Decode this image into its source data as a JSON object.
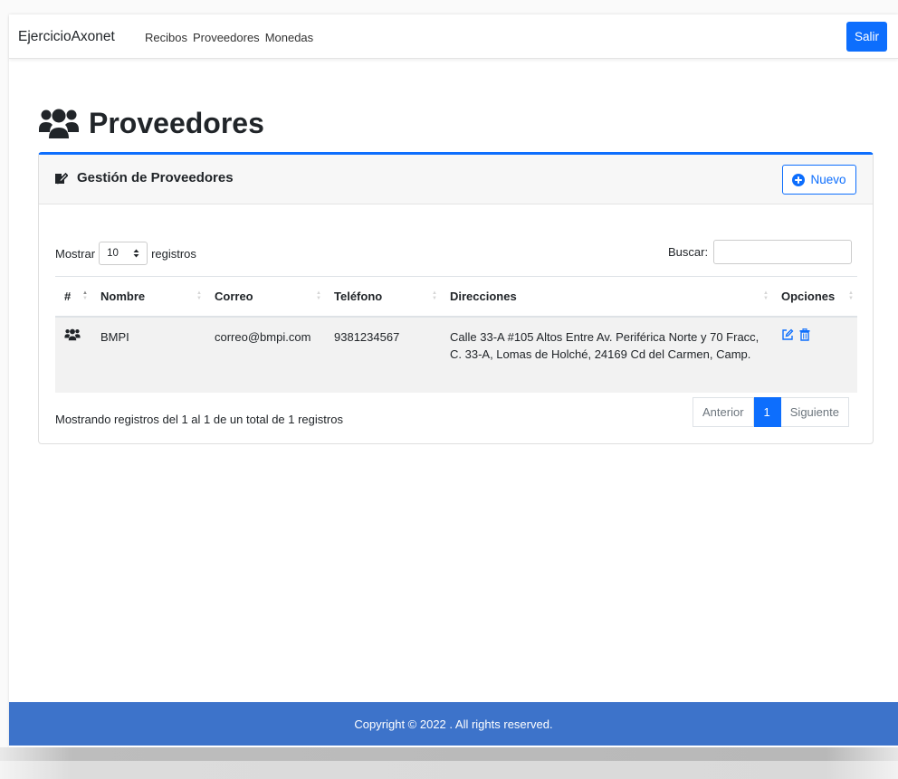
{
  "navbar": {
    "brand": "EjercicioAxonet",
    "links": [
      "Recibos",
      "Proveedores",
      "Monedas"
    ],
    "logout_label": "Salir"
  },
  "page": {
    "title": "Proveedores",
    "title_icon": "users-icon"
  },
  "card": {
    "header_title": "Gestión de Proveedores",
    "header_icon": "edit-document-icon",
    "new_button": "Nuevo",
    "new_button_icon": "plus-circle-icon"
  },
  "table_controls": {
    "show_label": "Mostrar",
    "page_length": "10",
    "records_label": "registros",
    "search_label": "Buscar:",
    "search_value": ""
  },
  "table": {
    "columns": [
      "#",
      "Nombre",
      "Correo",
      "Teléfono",
      "Direcciones",
      "Opciones"
    ],
    "rows": [
      {
        "icon": "users-icon",
        "nombre": "BMPI",
        "correo": "correo@bmpi.com",
        "telefono": "9381234567",
        "direccion": "Calle 33-A #105 Altos Entre Av. Periférica Norte y 70 Fracc, C. 33-A, Lomas de Holché, 24169 Cd del Carmen, Camp.",
        "actions": [
          "edit-icon",
          "trash-icon"
        ]
      }
    ]
  },
  "pagination": {
    "info": "Mostrando registros del 1 al 1 de un total de 1 registros",
    "previous": "Anterior",
    "current": "1",
    "next": "Siguiente"
  },
  "footer": {
    "copyright": "Copyright © 2022 . All rights reserved."
  },
  "colors": {
    "primary": "#0d6efd",
    "footer_bg": "#3d73ca"
  }
}
